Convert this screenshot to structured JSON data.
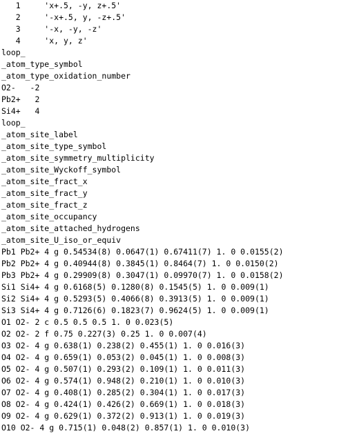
{
  "document": {
    "lines": [
      "   1     'x+.5, -y, z+.5'",
      "   2     '-x+.5, y, -z+.5'",
      "   3     '-x, -y, -z'",
      "   4     'x, y, z'",
      "loop_",
      "_atom_type_symbol",
      "_atom_type_oxidation_number",
      "O2-   -2",
      "Pb2+   2",
      "Si4+   4",
      "loop_",
      "_atom_site_label",
      "_atom_site_type_symbol",
      "_atom_site_symmetry_multiplicity",
      "_atom_site_Wyckoff_symbol",
      "_atom_site_fract_x",
      "_atom_site_fract_y",
      "_atom_site_fract_z",
      "_atom_site_occupancy",
      "_atom_site_attached_hydrogens",
      "_atom_site_U_iso_or_equiv",
      "Pb1 Pb2+ 4 g 0.54534(8) 0.0647(1) 0.67411(7) 1. 0 0.0155(2)",
      "Pb2 Pb2+ 4 g 0.40944(8) 0.3845(1) 0.8464(7) 1. 0 0.0150(2)",
      "Pb3 Pb2+ 4 g 0.29909(8) 0.3047(1) 0.09970(7) 1. 0 0.0158(2)",
      "Si1 Si4+ 4 g 0.6168(5) 0.1280(8) 0.1545(5) 1. 0 0.009(1)",
      "Si2 Si4+ 4 g 0.5293(5) 0.4066(8) 0.3913(5) 1. 0 0.009(1)",
      "Si3 Si4+ 4 g 0.7126(6) 0.1823(7) 0.9624(5) 1. 0 0.009(1)",
      "O1 O2- 2 c 0.5 0.5 0.5 1. 0 0.023(5)",
      "O2 O2- 2 f 0.75 0.227(3) 0.25 1. 0 0.007(4)",
      "O3 O2- 4 g 0.638(1) 0.238(2) 0.455(1) 1. 0 0.016(3)",
      "O4 O2- 4 g 0.659(1) 0.053(2) 0.045(1) 1. 0 0.008(3)",
      "O5 O2- 4 g 0.507(1) 0.293(2) 0.109(1) 1. 0 0.011(3)",
      "O6 O2- 4 g 0.574(1) 0.948(2) 0.210(1) 1. 0 0.010(3)",
      "O7 O2- 4 g 0.408(1) 0.285(2) 0.304(1) 1. 0 0.017(3)",
      "O8 O2- 4 g 0.424(1) 0.426(2) 0.669(1) 1. 0 0.018(3)",
      "O9 O2- 4 g 0.629(1) 0.372(2) 0.913(1) 1. 0 0.019(3)",
      "O10 O2- 4 g 0.715(1) 0.048(2) 0.857(1) 1. 0 0.010(3)"
    ]
  }
}
